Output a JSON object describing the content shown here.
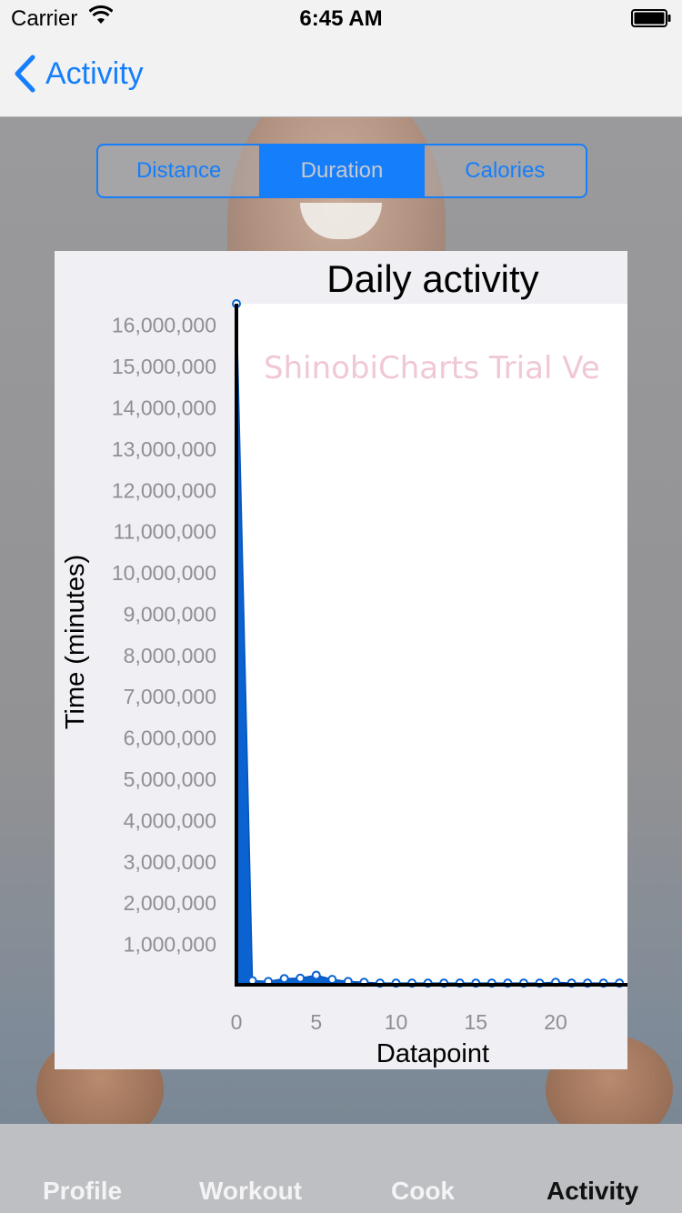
{
  "status_bar": {
    "carrier": "Carrier",
    "time": "6:45 AM"
  },
  "nav": {
    "back_label": "Activity"
  },
  "segments": [
    {
      "label": "Distance",
      "selected": false
    },
    {
      "label": "Duration",
      "selected": true
    },
    {
      "label": "Calories",
      "selected": false
    }
  ],
  "chart_data": {
    "type": "area",
    "title": "Daily activity",
    "xlabel": "Datapoint",
    "ylabel": "Time (minutes)",
    "watermark": "ShinobiCharts Trial Ve",
    "xlim": [
      0,
      24
    ],
    "ylim": [
      0,
      16500000
    ],
    "x_ticks": [
      0,
      5,
      10,
      15,
      20
    ],
    "x_tick_labels": [
      "0",
      "5",
      "10",
      "15",
      "20"
    ],
    "y_ticks": [
      1000000,
      2000000,
      3000000,
      4000000,
      5000000,
      6000000,
      7000000,
      8000000,
      9000000,
      10000000,
      11000000,
      12000000,
      13000000,
      14000000,
      15000000,
      16000000
    ],
    "y_tick_labels": [
      "1,000,000",
      "2,000,000",
      "3,000,000",
      "4,000,000",
      "5,000,000",
      "6,000,000",
      "7,000,000",
      "8,000,000",
      "9,000,000",
      "10,000,000",
      "11,000,000",
      "12,000,000",
      "13,000,000",
      "14,000,000",
      "15,000,000",
      "16,000,000"
    ],
    "grid": false,
    "series": [
      {
        "color": "#0a63d0",
        "x": [
          0,
          1,
          2,
          3,
          4,
          5,
          6,
          7,
          8,
          9,
          10,
          11,
          12,
          13,
          14,
          15,
          16,
          17,
          18,
          19,
          20,
          21,
          22,
          23,
          24
        ],
        "y": [
          16500000,
          100000,
          80000,
          150000,
          160000,
          230000,
          130000,
          80000,
          60000,
          40000,
          40000,
          40000,
          40000,
          40000,
          40000,
          40000,
          40000,
          40000,
          40000,
          40000,
          60000,
          40000,
          40000,
          40000,
          40000
        ]
      }
    ]
  },
  "tabs": [
    {
      "label": "Profile",
      "active": false
    },
    {
      "label": "Workout",
      "active": false
    },
    {
      "label": "Cook",
      "active": false
    },
    {
      "label": "Activity",
      "active": true
    }
  ]
}
